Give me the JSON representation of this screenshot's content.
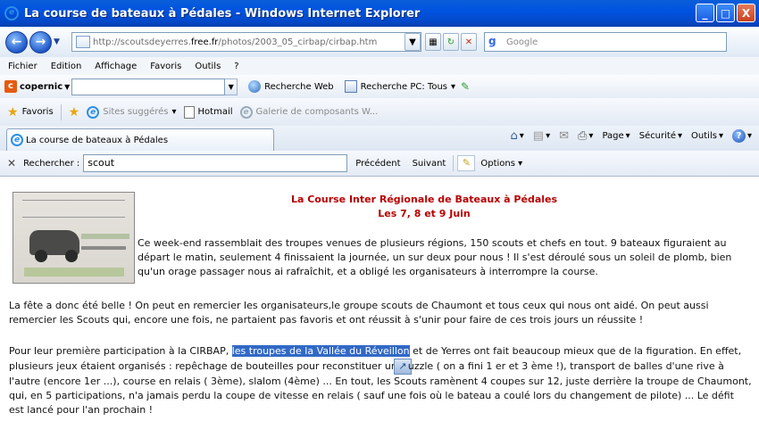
{
  "window": {
    "title": "La course de bateaux à Pédales - Windows Internet Explorer",
    "controls": [
      "_",
      "□",
      "X"
    ]
  },
  "address": {
    "url_prefix": "http://scoutsdeyerres.",
    "url_domain": "free.fr",
    "url_suffix": "/photos/2003_05_cirbap/cirbap.htm",
    "search_placeholder": "Google"
  },
  "menu": {
    "items": [
      "Fichier",
      "Edition",
      "Affichage",
      "Favoris",
      "Outils",
      "?"
    ]
  },
  "copernic": {
    "logo": "copernic",
    "web_search": "Recherche Web",
    "pc_search": "Recherche PC: Tous"
  },
  "favorites_bar": {
    "favorites": "Favoris",
    "suggested": "Sites suggérés",
    "hotmail": "Hotmail",
    "gallery": "Galerie de composants W..."
  },
  "tab": {
    "title": "La course de bateaux à Pédales"
  },
  "tools": {
    "page": "Page",
    "security": "Sécurité",
    "tools": "Outils"
  },
  "find": {
    "label": "Rechercher :",
    "value": "scout",
    "previous": "Précédent",
    "next": "Suivant",
    "options": "Options"
  },
  "page": {
    "heading_line1": "La Course Inter Régionale de Bateaux à Pédales",
    "heading_line2": "Les 7, 8 et 9 Juin",
    "para1": "Ce week-end rassemblait des troupes venues de plusieurs régions, 150 scouts et chefs en tout. 9 bateaux figuraient au départ le matin, seulement 4 finissaient la journée, un sur deux pour nous ! Il s'est déroulé sous un soleil de plomb, bien qu'un orage passager nous ai rafraîchit, et a obligé les organisateurs à interrompre la course.",
    "para2": "La fête a donc été belle ! On peut en remercier les organisateurs,le groupe scouts de Chaumont et tous ceux qui nous ont aidé. On peut aussi remercier les Scouts qui, encore une fois, ne partaient pas favoris et ont réussit à s'unir pour faire de ces trois jours un réussite !",
    "para3_before": "Pour leur première participation à la CIRBAP, ",
    "para3_highlight": "les troupes de la Vallée du Réveillon",
    "para3_mid": " et de Yerres ont fait beaucoup mieux que de la figuration. En effet, plusieurs jeux étaient organisés : repêchage de bouteilles pour reconstituer un",
    "para3_after": "uzzle ( on a fini 1 er et 3 ème !), transport de balles d'une rive à l'autre (encore 1er ...), course en relais ( 3ème), slalom (4ème) ... En tout, les Scouts ramènent 4 coupes sur 12, juste derrière la troupe de Chaumont, qui, en 5 participations, n'a jamais perdu la coupe de vitesse en relais ( sauf une fois où le bateau a coulé lors du changement de pilote) ... Le défit est lancé pour l'an prochain !"
  }
}
